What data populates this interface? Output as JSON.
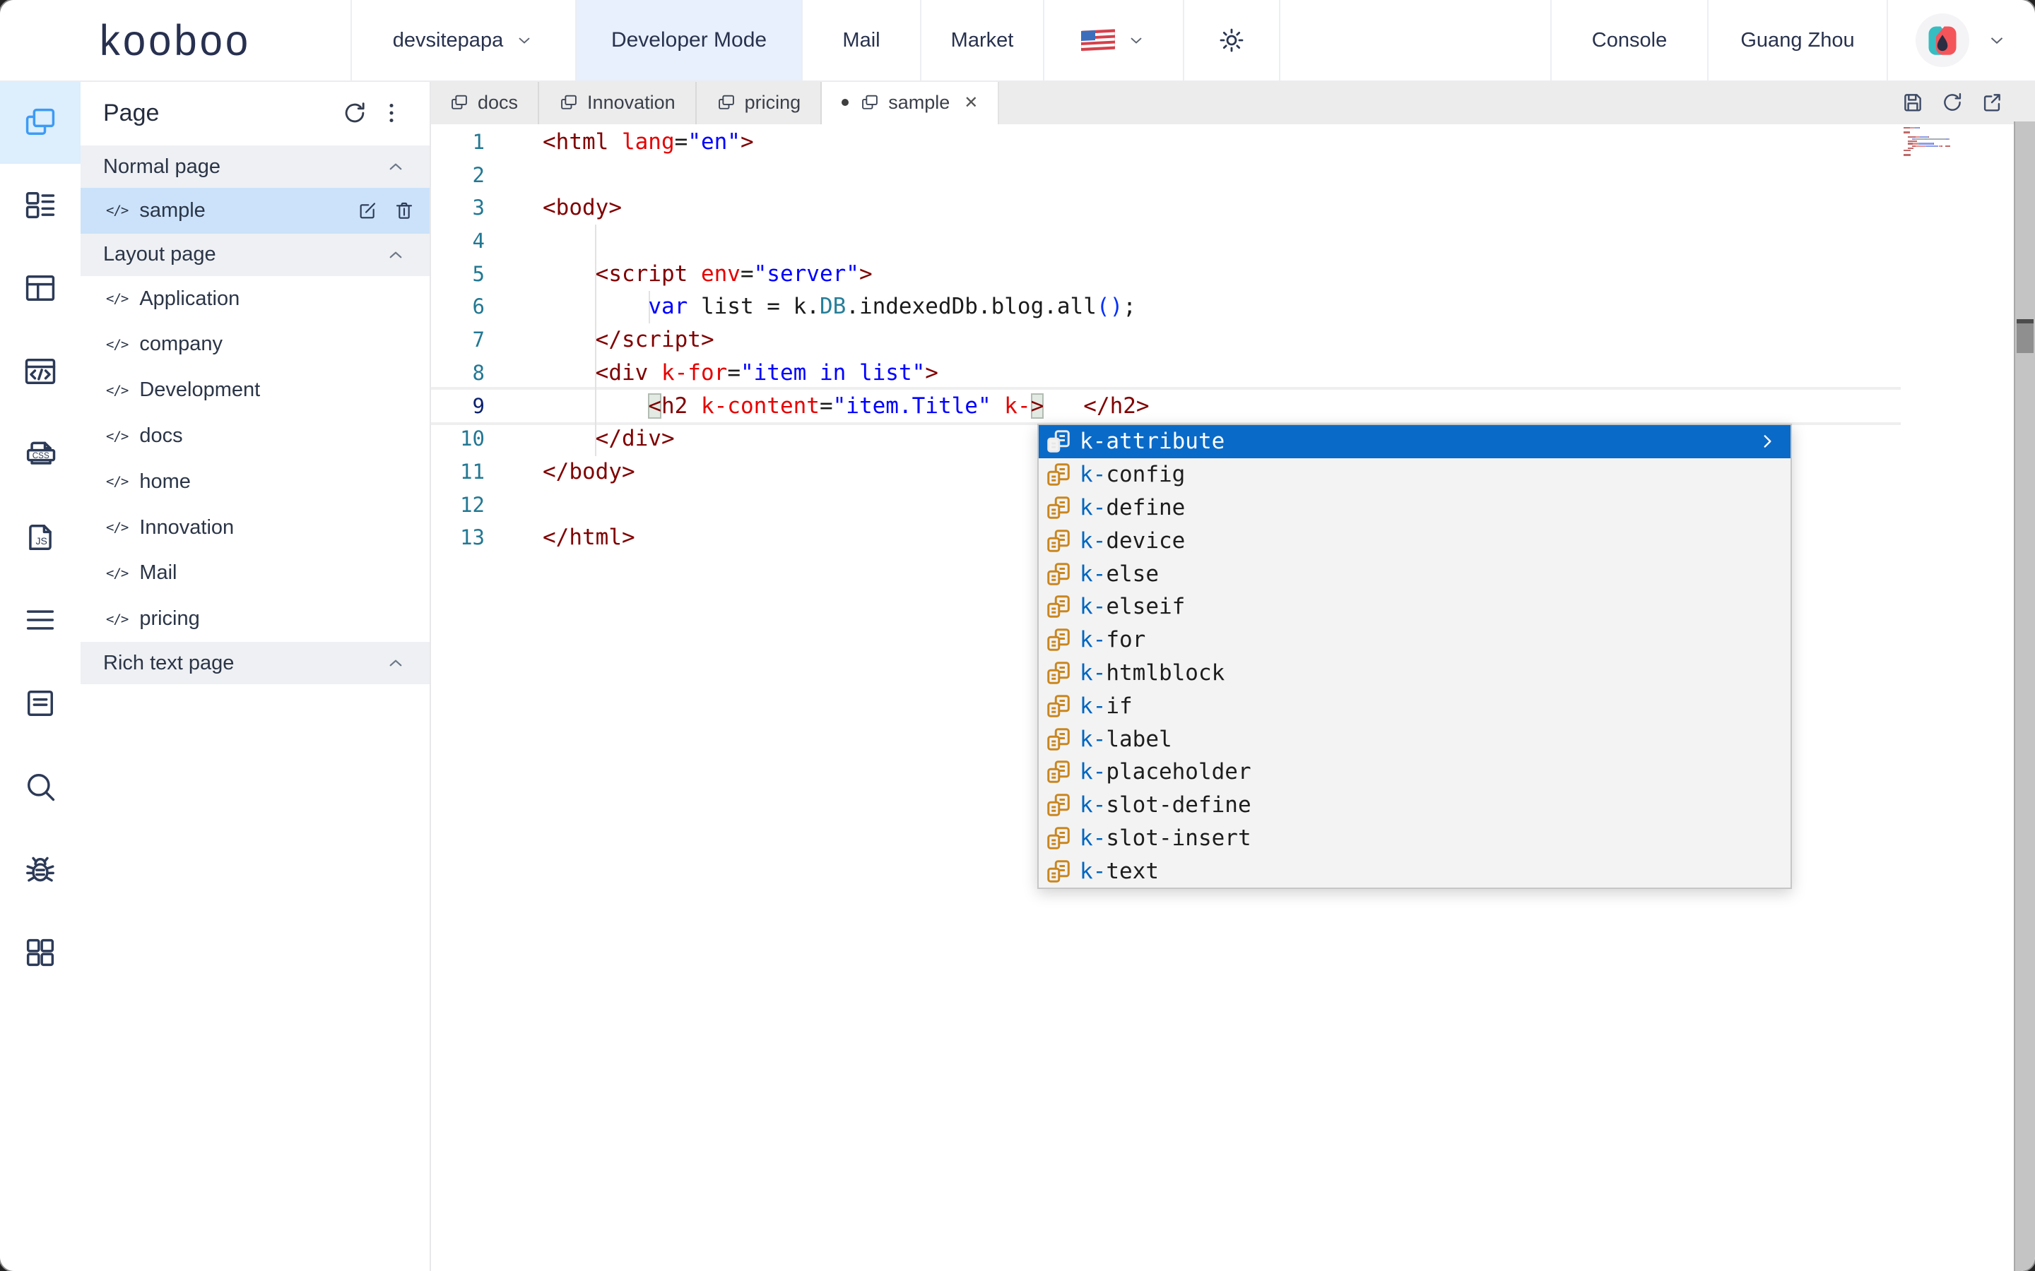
{
  "topbar": {
    "logo_text": "kooboo",
    "site_name": "devsitepapa",
    "developer_mode_label": "Developer Mode",
    "mail_label": "Mail",
    "market_label": "Market",
    "console_label": "Console",
    "location_label": "Guang Zhou"
  },
  "rail": {
    "items": [
      {
        "icon": "pages-icon",
        "active": true
      },
      {
        "icon": "list-detail-icon",
        "active": false
      },
      {
        "icon": "layout-icon",
        "active": false
      },
      {
        "icon": "code-window-icon",
        "active": false
      },
      {
        "icon": "css-file-icon",
        "active": false
      },
      {
        "icon": "js-file-icon",
        "active": false
      },
      {
        "icon": "menu-icon",
        "active": false
      },
      {
        "icon": "form-icon",
        "active": false
      },
      {
        "icon": "search-icon",
        "active": false
      },
      {
        "icon": "bug-icon",
        "active": false
      },
      {
        "icon": "modules-icon",
        "active": false
      }
    ]
  },
  "panel": {
    "title": "Page",
    "sections": [
      {
        "label": "Normal page",
        "items": [
          {
            "label": "sample",
            "selected": true
          }
        ]
      },
      {
        "label": "Layout page",
        "items": [
          {
            "label": "Application"
          },
          {
            "label": "company"
          },
          {
            "label": "Development"
          },
          {
            "label": "docs"
          },
          {
            "label": "home"
          },
          {
            "label": "Innovation"
          },
          {
            "label": "Mail"
          },
          {
            "label": "pricing"
          }
        ]
      },
      {
        "label": "Rich text page",
        "items": []
      }
    ]
  },
  "tabs": {
    "items": [
      {
        "label": "docs"
      },
      {
        "label": "Innovation"
      },
      {
        "label": "pricing"
      },
      {
        "label": "sample",
        "active": true,
        "dirty": true
      }
    ]
  },
  "editor": {
    "lines": [
      {
        "n": 1,
        "tokens": [
          {
            "t": "<html ",
            "c": "tag"
          },
          {
            "t": "lang",
            "c": "attr"
          },
          {
            "t": "=",
            "c": "plain"
          },
          {
            "t": "\"en\"",
            "c": "val"
          },
          {
            "t": ">",
            "c": "tag"
          }
        ]
      },
      {
        "n": 2,
        "tokens": []
      },
      {
        "n": 3,
        "tokens": [
          {
            "t": "<body>",
            "c": "tag"
          }
        ]
      },
      {
        "n": 4,
        "tokens": []
      },
      {
        "n": 5,
        "tokens": [
          {
            "t": "    ",
            "c": "plain"
          },
          {
            "t": "<script ",
            "c": "tag"
          },
          {
            "t": "env",
            "c": "attr"
          },
          {
            "t": "=",
            "c": "plain"
          },
          {
            "t": "\"server\"",
            "c": "val"
          },
          {
            "t": ">",
            "c": "tag"
          }
        ]
      },
      {
        "n": 6,
        "tokens": [
          {
            "t": "        ",
            "c": "plain"
          },
          {
            "t": "var",
            "c": "kw"
          },
          {
            "t": " list = k.",
            "c": "plain"
          },
          {
            "t": "DB",
            "c": "type"
          },
          {
            "t": ".indexedDb.blog.all",
            "c": "plain"
          },
          {
            "t": "(",
            "c": "paren"
          },
          {
            "t": ")",
            "c": "paren"
          },
          {
            "t": ";",
            "c": "plain"
          }
        ]
      },
      {
        "n": 7,
        "tokens": [
          {
            "t": "    ",
            "c": "plain"
          },
          {
            "t": "</script>",
            "c": "tag"
          }
        ]
      },
      {
        "n": 8,
        "tokens": [
          {
            "t": "    ",
            "c": "plain"
          },
          {
            "t": "<div ",
            "c": "tag"
          },
          {
            "t": "k-for",
            "c": "attr"
          },
          {
            "t": "=",
            "c": "plain"
          },
          {
            "t": "\"item in list\"",
            "c": "val"
          },
          {
            "t": ">",
            "c": "tag"
          }
        ]
      },
      {
        "n": 9,
        "tokens": [
          {
            "t": "        ",
            "c": "plain"
          },
          {
            "t": "<",
            "c": "tag",
            "m": true
          },
          {
            "t": "h2 ",
            "c": "tag"
          },
          {
            "t": "k-content",
            "c": "attr"
          },
          {
            "t": "=",
            "c": "plain"
          },
          {
            "t": "\"item.Title\"",
            "c": "val"
          },
          {
            "t": " ",
            "c": "plain"
          },
          {
            "t": "k-",
            "c": "attr"
          },
          {
            "t": ">",
            "c": "tag",
            "m": true
          },
          {
            "t": "   ",
            "c": "plain"
          },
          {
            "t": "</h2>",
            "c": "tag"
          }
        ]
      },
      {
        "n": 10,
        "tokens": [
          {
            "t": "    ",
            "c": "plain"
          },
          {
            "t": "</div>",
            "c": "tag"
          }
        ]
      },
      {
        "n": 11,
        "tokens": [
          {
            "t": "</body>",
            "c": "tag"
          }
        ]
      },
      {
        "n": 12,
        "tokens": []
      },
      {
        "n": 13,
        "tokens": [
          {
            "t": "</html>",
            "c": "tag"
          }
        ]
      }
    ],
    "current_line": 9
  },
  "popup": {
    "items": [
      {
        "label": "k-attribute",
        "selected": true,
        "has_more": true
      },
      {
        "label": "k-config"
      },
      {
        "label": "k-define"
      },
      {
        "label": "k-device"
      },
      {
        "label": "k-else"
      },
      {
        "label": "k-elseif"
      },
      {
        "label": "k-for"
      },
      {
        "label": "k-htmlblock"
      },
      {
        "label": "k-if"
      },
      {
        "label": "k-label"
      },
      {
        "label": "k-placeholder"
      },
      {
        "label": "k-slot-define"
      },
      {
        "label": "k-slot-insert"
      },
      {
        "label": "k-text"
      }
    ],
    "matched_prefix": "k-"
  },
  "colors": {
    "accent_blue": "#3d9bf5",
    "selected_item_bg": "#cbe2fa",
    "devmode_bg": "#e7f0fc",
    "popup_selected_bg": "#0a6ac8",
    "match_prefix_blue": "#0066bf",
    "token_tag": "#800000",
    "token_attr": "#e60000",
    "token_value": "#0000ff",
    "token_keyword": "#0000ff",
    "token_type": "#267f99",
    "line_number": "#237893",
    "logo_navy": "#27304f",
    "avatar_teal": "#36bdc2",
    "avatar_red": "#f4555a",
    "avatar_navy": "#2b2d42"
  }
}
